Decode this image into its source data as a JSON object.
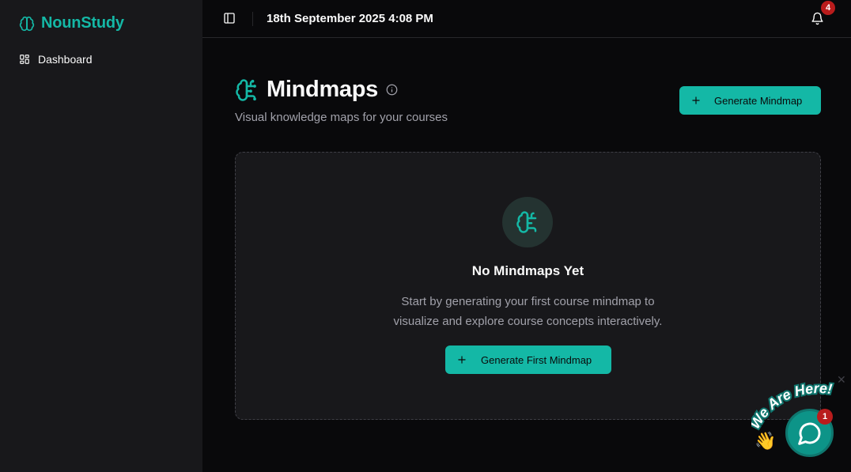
{
  "brand": {
    "name": "NounStudy",
    "icon": "brain-icon"
  },
  "sidebar": {
    "items": [
      {
        "label": "Dashboard",
        "icon": "layout-grid-icon"
      }
    ]
  },
  "topbar": {
    "datetime": "18th September 2025 4:08 PM",
    "notification_count": "4"
  },
  "page": {
    "title": "Mindmaps",
    "subtitle": "Visual knowledge maps for your courses",
    "generate_button": "Generate Mindmap"
  },
  "empty_state": {
    "title": "No Mindmaps Yet",
    "description_line1": "Start by generating your first course mindmap to",
    "description_line2": "visualize and explore course concepts interactively.",
    "button": "Generate First Mindmap"
  },
  "chat_widget": {
    "tagline": "We Are Here!",
    "badge_count": "1",
    "wave_emoji": "👋"
  },
  "colors": {
    "accent": "#14b8a6",
    "sidebar_bg": "#18181b",
    "page_bg": "#09090b",
    "badge": "#b91c1c"
  }
}
